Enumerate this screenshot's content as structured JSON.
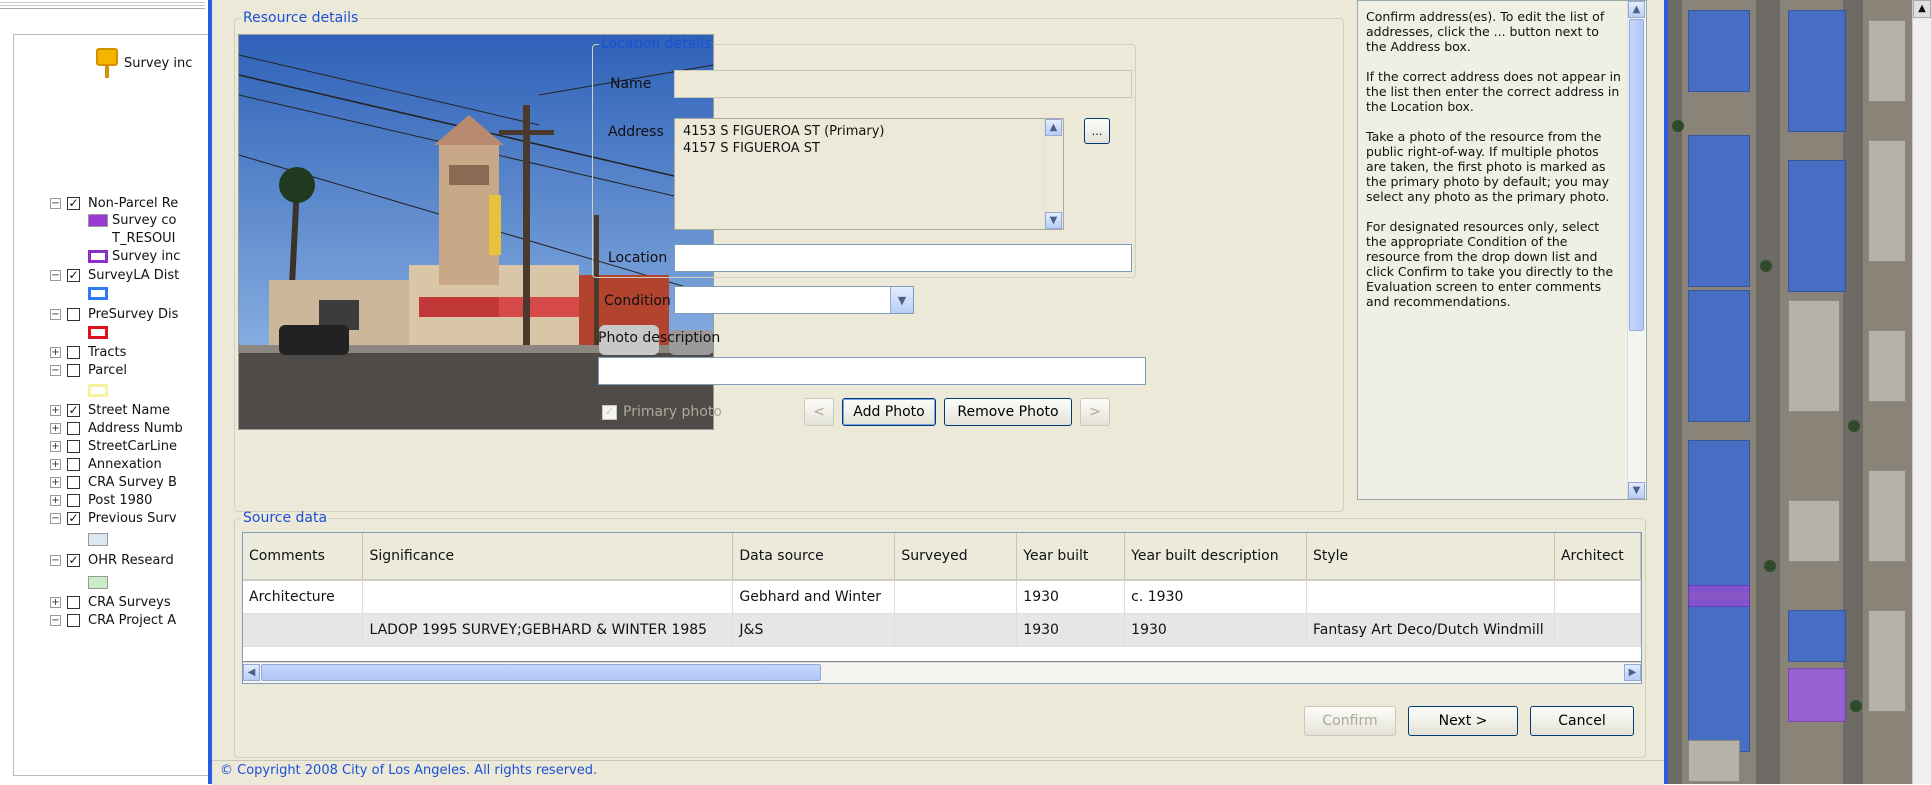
{
  "legend": {
    "survey_label": "Survey inc",
    "rows": [
      {
        "expander": "−",
        "checked": true,
        "label": "Non-Parcel Re"
      },
      {
        "type": "swatch",
        "color": "#9a3ad6",
        "label": "Survey co"
      },
      {
        "type": "text",
        "label": "T_RESOUI"
      },
      {
        "type": "swatch",
        "color": "#8a2fc7",
        "outline": true,
        "label": "Survey inc"
      },
      {
        "expander": "−",
        "checked": true,
        "label": "SurveyLA Dist"
      },
      {
        "type": "swatch",
        "color": "#2f7af5",
        "outline": true,
        "label": ""
      },
      {
        "expander": "−",
        "checked": false,
        "label": "PreSurvey Dis"
      },
      {
        "type": "swatch",
        "color": "#e0101a",
        "outline": true,
        "label": ""
      },
      {
        "expander": "+",
        "checked": false,
        "label": "Tracts"
      },
      {
        "expander": "−",
        "checked": false,
        "label": "Parcel"
      },
      {
        "type": "swatch",
        "color": "#f7f2a0",
        "outline": true,
        "label": ""
      },
      {
        "expander": "+",
        "checked": true,
        "label": "Street Name"
      },
      {
        "expander": "+",
        "checked": false,
        "label": "Address Numb"
      },
      {
        "expander": "+",
        "checked": false,
        "label": "StreetCarLine"
      },
      {
        "expander": "+",
        "checked": false,
        "label": "Annexation"
      },
      {
        "expander": "+",
        "checked": false,
        "label": "CRA Survey B"
      },
      {
        "expander": "+",
        "checked": false,
        "label": "Post 1980"
      },
      {
        "expander": "−",
        "checked": true,
        "label": "Previous Surv"
      },
      {
        "type": "swatch",
        "color": "#dbe8f4",
        "label": ""
      },
      {
        "expander": "−",
        "checked": true,
        "label": "OHR Researd"
      },
      {
        "type": "swatch",
        "color": "#c8ecc8",
        "label": ""
      },
      {
        "expander": "+",
        "checked": false,
        "label": "CRA Surveys"
      },
      {
        "expander": "−",
        "checked": false,
        "label": "CRA Project A"
      }
    ]
  },
  "dialog": {
    "resource_details_title": "Resource details",
    "location_details_title": "Location details",
    "name_label": "Name",
    "name_value": "",
    "address_label": "Address",
    "address_lines": [
      "4153 S FIGUEROA ST (Primary)",
      "4157 S FIGUEROA ST"
    ],
    "address_more_button": "...",
    "location_label": "Location",
    "location_value": "",
    "condition_label": "Condition",
    "condition_value": "",
    "photo_description_label": "Photo description",
    "photo_description_value": "",
    "primary_photo_label": "Primary photo",
    "prev_button": "<",
    "add_photo_button": "Add Photo",
    "remove_photo_button": "Remove Photo",
    "next_photo_button": ">",
    "help_text": "Confirm address(es). To edit the list of addresses, click the ... button next to the Address box.\n\nIf the correct address does not appear in the list then enter the correct address in the Location box.\n\nTake a photo of the resource from the public right-of-way. If multiple photos are taken, the first photo is marked as the primary photo by default; you may select any photo as the primary photo.\n\nFor designated resources only, select the appropriate Condition of the resource from the drop down list and click Confirm to take you directly to the Evaluation screen to enter comments and recommendations.",
    "source_data_title": "Source data",
    "table": {
      "columns": [
        "Comments",
        "Significance",
        "Data source",
        "Surveyed",
        "Year built",
        "Year built description",
        "Style",
        "Architect"
      ],
      "rows": [
        [
          "Architecture",
          "",
          "Gebhard and Winter",
          "",
          "1930",
          "c. 1930",
          "",
          ""
        ],
        [
          "",
          "LADOP 1995 SURVEY;GEBHARD & WINTER 1985",
          "J&S",
          "",
          "1930",
          "1930",
          "Fantasy Art Deco/Dutch Windmill",
          ""
        ]
      ]
    },
    "confirm_button": "Confirm",
    "next_button": "Next >",
    "cancel_button": "Cancel",
    "copyright": "© Copyright 2008 City of Los Angeles. All rights reserved."
  }
}
